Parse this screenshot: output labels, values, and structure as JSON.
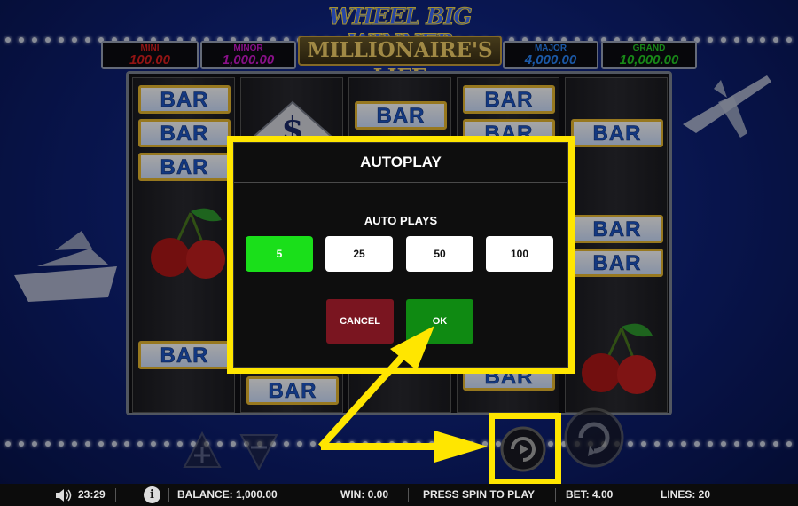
{
  "game": {
    "logo_line1": "WHEEL BIG WINNER",
    "logo_line2": "MILLIONAIRE'S LIFE"
  },
  "jackpots": [
    {
      "label": "MINI",
      "value": "100.00",
      "label_color": "#e02020",
      "value_color": "#e02020"
    },
    {
      "label": "MINOR",
      "value": "1,000.00",
      "label_color": "#d21ad2",
      "value_color": "#d21ad2"
    },
    {
      "label": "MAJOR",
      "value": "4,000.00",
      "label_color": "#2a88ff",
      "value_color": "#2a88ff"
    },
    {
      "label": "GRAND",
      "value": "10,000.00",
      "label_color": "#25d125",
      "value_color": "#25d125"
    }
  ],
  "symbols": {
    "bar_text": "BAR",
    "dollar_text": "$"
  },
  "modal": {
    "title": "AUTOPLAY",
    "subtitle": "AUTO PLAYS",
    "options": [
      "5",
      "25",
      "50",
      "100"
    ],
    "selected_index": 0,
    "cancel_label": "CANCEL",
    "ok_label": "OK"
  },
  "status_bar": {
    "time": "23:29",
    "info_icon": "i",
    "balance": "BALANCE: 1,000.00",
    "win": "WIN: 0.00",
    "message": "PRESS SPIN TO PLAY",
    "bet": "BET: 4.00",
    "lines": "LINES: 20"
  },
  "colors": {
    "highlight": "#ffe600",
    "option_selected": "#1adf1a",
    "cancel": "#7a1520",
    "ok": "#0f8a12"
  },
  "icons": {
    "volume": "speaker-icon",
    "info": "info-icon",
    "spin": "spin-icon",
    "autoplay": "autoplay-icon",
    "plus": "plus-icon",
    "minus": "minus-icon"
  }
}
